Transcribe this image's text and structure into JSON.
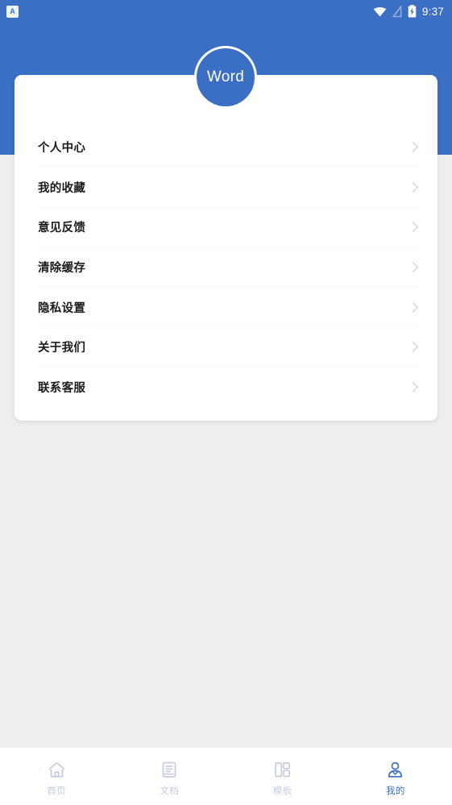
{
  "status_bar": {
    "notification_icon": "app-notification-icon",
    "notification_letter": "A",
    "wifi_icon": "wifi-icon",
    "signal_icon": "no-sim-signal-icon",
    "battery_icon": "battery-charging-icon",
    "time": "9:37"
  },
  "header": {
    "background_color": "#3a6fc4",
    "avatar_label": "Word",
    "avatar_icon": "word-avatar"
  },
  "menu": {
    "items": [
      {
        "label": "个人中心",
        "name": "menu-item-personal-center",
        "chevron": "chevron-right-icon"
      },
      {
        "label": "我的收藏",
        "name": "menu-item-my-favorites",
        "chevron": "chevron-right-icon"
      },
      {
        "label": "意见反馈",
        "name": "menu-item-feedback",
        "chevron": "chevron-right-icon"
      },
      {
        "label": "清除缓存",
        "name": "menu-item-clear-cache",
        "chevron": "chevron-right-icon"
      },
      {
        "label": "隐私设置",
        "name": "menu-item-privacy-settings",
        "chevron": "chevron-right-icon"
      },
      {
        "label": "关于我们",
        "name": "menu-item-about-us",
        "chevron": "chevron-right-icon"
      },
      {
        "label": "联系客服",
        "name": "menu-item-contact-support",
        "chevron": "chevron-right-icon"
      }
    ]
  },
  "bottom_nav": {
    "active_color": "#3a6fc4",
    "inactive_color": "#c6cde0",
    "items": [
      {
        "label": "首页",
        "icon": "home-icon",
        "active": false
      },
      {
        "label": "文档",
        "icon": "document-icon",
        "active": false
      },
      {
        "label": "模板",
        "icon": "template-grid-icon",
        "active": false
      },
      {
        "label": "我的",
        "icon": "person-icon",
        "active": true
      }
    ]
  }
}
